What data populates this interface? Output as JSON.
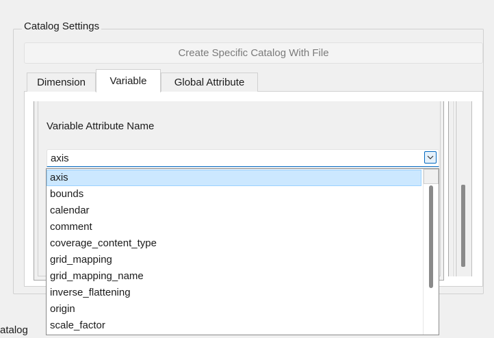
{
  "catalog_settings": {
    "title": "Catalog Settings",
    "create_button": "Create Specific Catalog With File"
  },
  "tabs": [
    {
      "label": "Dimension",
      "active": false
    },
    {
      "label": "Variable",
      "active": true
    },
    {
      "label": "Global Attribute",
      "active": false
    }
  ],
  "variable_panel": {
    "field_label": "Variable Attribute Name",
    "combo_value": "axis",
    "options": [
      "axis",
      "bounds",
      "calendar",
      "comment",
      "coverage_content_type",
      "grid_mapping",
      "grid_mapping_name",
      "inverse_flattening",
      "origin",
      "scale_factor"
    ],
    "selected_option": "axis"
  },
  "bottom_fragment": "atalog",
  "colors": {
    "accent": "#0067c0",
    "selection": "#cce8ff",
    "background": "#f0f0f0"
  }
}
